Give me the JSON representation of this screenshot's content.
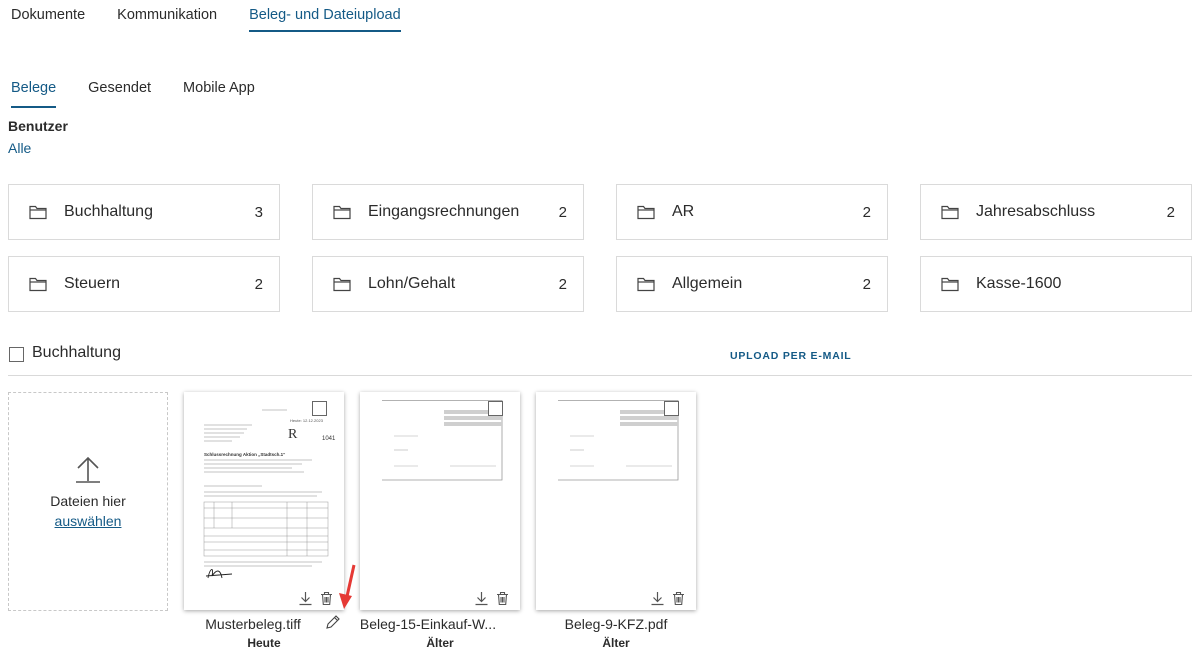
{
  "top_tabs": [
    "Dokumente",
    "Kommunikation",
    "Beleg- und Dateiupload"
  ],
  "sub_tabs": [
    "Belege",
    "Gesendet",
    "Mobile App"
  ],
  "user_filter": {
    "label": "Benutzer",
    "value": "Alle"
  },
  "folders": [
    {
      "name": "Buchhaltung",
      "count": "3"
    },
    {
      "name": "Eingangsrechnungen",
      "count": "2"
    },
    {
      "name": "AR",
      "count": "2"
    },
    {
      "name": "Jahresabschluss",
      "count": "2"
    },
    {
      "name": "Steuern",
      "count": "2"
    },
    {
      "name": "Lohn/Gehalt",
      "count": "2"
    },
    {
      "name": "Allgemein",
      "count": "2"
    },
    {
      "name": "Kasse-1600",
      "count": ""
    }
  ],
  "section": {
    "title": "Buchhaltung",
    "upload_email": "UPLOAD PER E-MAIL"
  },
  "dropzone": {
    "text": "Dateien hier",
    "link": "auswählen"
  },
  "documents": [
    {
      "filename": "Musterbeleg.tiff",
      "date": "Heute"
    },
    {
      "filename": "Beleg-15-Einkauf-W...",
      "date": "Älter"
    },
    {
      "filename": "Beleg-9-KFZ.pdf",
      "date": "Älter"
    }
  ],
  "doc_thumb_text": {
    "title": "Schlussrechnung Aktion „Stadtsch.1“",
    "stamp": "R",
    "number": "1041",
    "date": "Heute: 12.12.2023"
  },
  "colors": {
    "accent": "#145a86",
    "annotation_arrow": "#e53935"
  }
}
